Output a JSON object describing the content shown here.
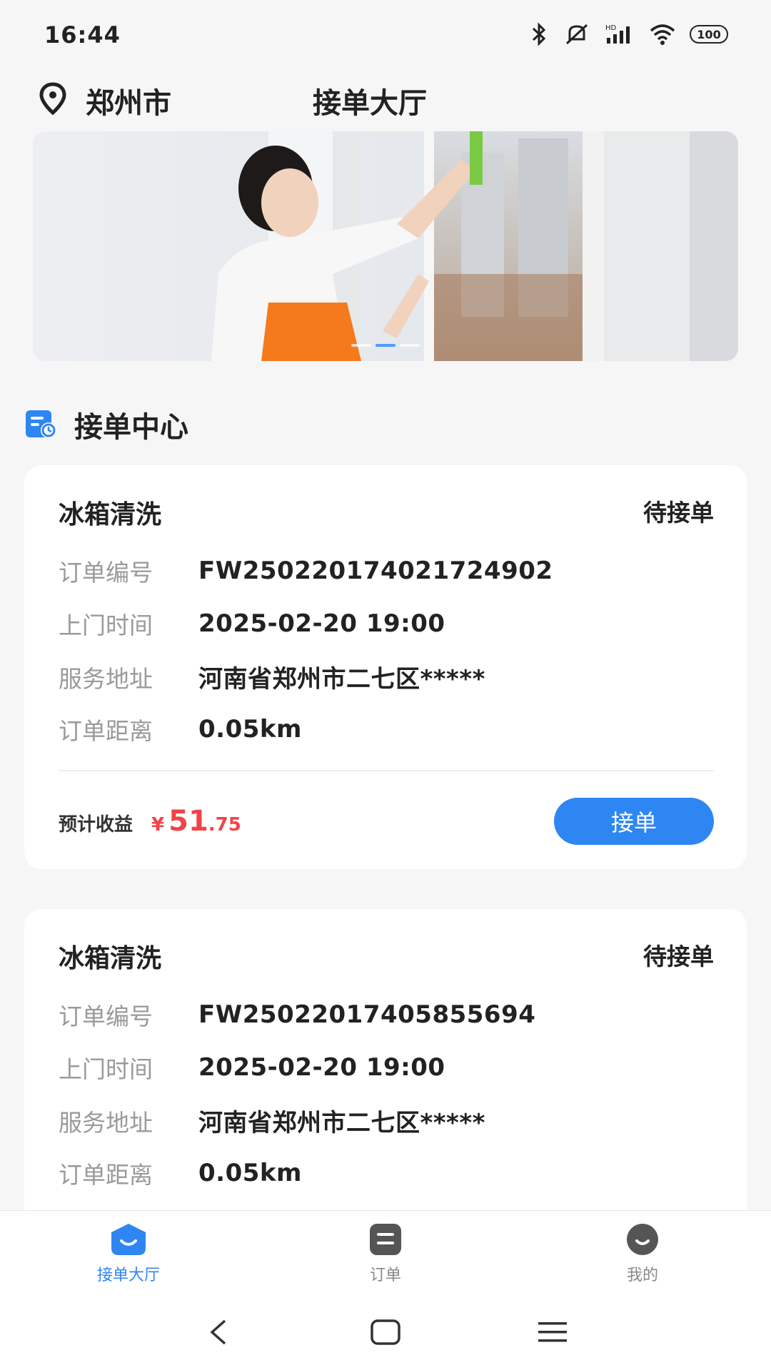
{
  "status_bar": {
    "time": "16:44",
    "battery": "100",
    "icons": [
      "bluetooth-icon",
      "mute-icon",
      "signal-icon",
      "wifi-icon",
      "battery-icon"
    ]
  },
  "header": {
    "city": "郑州市",
    "title": "接单大厅"
  },
  "section": {
    "title": "接单中心"
  },
  "orders": [
    {
      "service": "冰箱清洗",
      "status": "待接单",
      "order_no_label": "订单编号",
      "order_no": "FW25022017402172490​2",
      "time_label": "上门时间",
      "time": "2025-02-20 19:00",
      "address_label": "服务地址",
      "address": "河南省郑州市二七区*****",
      "distance_label": "订单距离",
      "distance": "0.05km",
      "earning_label": "预计收益",
      "currency": "¥",
      "earning_int": "51",
      "earning_dec": ".75",
      "accept_label": "接单"
    },
    {
      "service": "冰箱清洗",
      "status": "待接单",
      "order_no_label": "订单编号",
      "order_no": "FW25022017405855694",
      "time_label": "上门时间",
      "time": "2025-02-20 19:00",
      "address_label": "服务地址",
      "address": "河南省郑州市二七区*****",
      "distance_label": "订单距离",
      "distance": "0.05km"
    }
  ],
  "tabs": [
    {
      "label": "接单大厅",
      "icon": "hall-icon",
      "active": true
    },
    {
      "label": "订单",
      "icon": "orders-icon",
      "active": false
    },
    {
      "label": "我的",
      "icon": "profile-icon",
      "active": false
    }
  ],
  "colors": {
    "accent": "#2e86f2",
    "price": "#f2434a",
    "background": "#f6f6f6"
  }
}
